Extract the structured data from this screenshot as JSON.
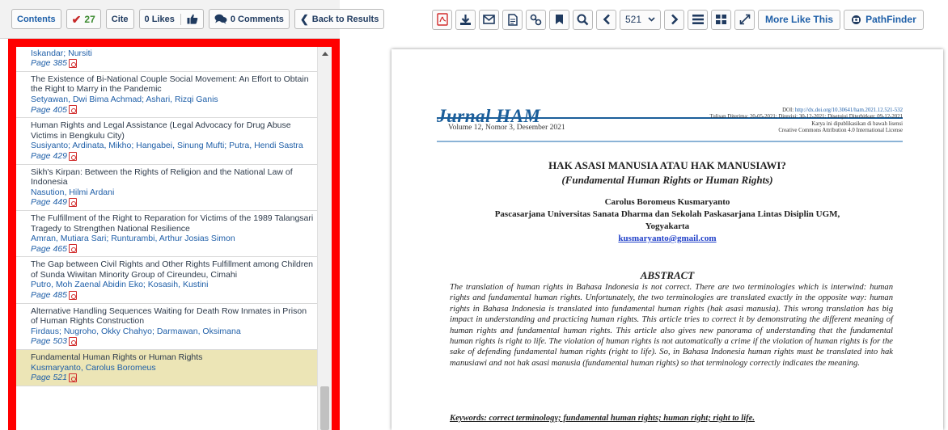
{
  "left_toolbar": {
    "contents": "Contents",
    "check_count": "27",
    "cite": "Cite",
    "likes": "0 Likes",
    "comments": "0 Comments",
    "back": "Back to Results"
  },
  "list": {
    "entries": [
      {
        "title": "",
        "authors": "Iskandar; Nursiti",
        "page": "Page 385",
        "partial": true
      },
      {
        "title": "The Existence of Bi-National Couple Social Movement: An Effort to Obtain the Right to Marry in the Pandemic",
        "authors": "Setyawan, Dwi Bima Achmad; Ashari, Rizqi Ganis",
        "page": "Page 405"
      },
      {
        "title": "Human Rights and Legal Assistance (Legal Advocacy for Drug Abuse Victims in Bengkulu City)",
        "authors": "Susiyanto; Ardinata, Mikho; Hangabei, Sinung Mufti; Putra, Hendi Sastra",
        "page": "Page 429"
      },
      {
        "title": "Sikh's Kirpan: Between the Rights of Religion and the National Law of Indonesia",
        "authors": "Nasution, Hilmi Ardani",
        "page": "Page 449"
      },
      {
        "title": "The Fulfillment of the Right to Reparation for Victims of the 1989 Talangsari Tragedy to Strengthen National Resilience",
        "authors": "Amran, Mutiara Sari; Runturambi, Arthur Josias Simon",
        "page": "Page 465"
      },
      {
        "title": "The Gap between Civil Rights and Other Rights Fulfillment among Children of Sunda Wiwitan Minority Group of Cireundeu, Cimahi",
        "authors": "Putro, Moh Zaenal Abidin Eko; Kosasih, Kustini",
        "page": "Page 485"
      },
      {
        "title": "Alternative Handling Sequences Waiting for Death Row Inmates in Prison of Human Rights Construction",
        "authors": "Firdaus; Nugroho, Okky Chahyo; Darmawan, Oksimana",
        "page": "Page 503"
      },
      {
        "title": "Fundamental Human Rights or Human Rights",
        "authors": "Kusmaryanto, Carolus Boromeus",
        "page": "Page 521",
        "active": true
      }
    ]
  },
  "right_toolbar": {
    "page_number": "521",
    "more_like_this": "More Like This",
    "pathfinder": "PathFinder"
  },
  "document": {
    "journal_name": "Jurnal HAM",
    "volume": "Volume 12, Nomor 3, Desember 2021",
    "doi_label": "DOI:",
    "doi_url": "http://dx.doi.org/10.30641/ham.2021.12.521-532",
    "dates": "Tulisan Diterima: 20-05-2021; Direvisi: 30-12-2021; Disetujui Diterbitkan: 09-12-2021",
    "license1": "Karya ini dipublikasikan di bawah lisensi",
    "license2": "Creative Commons Attribution 4.0 International License",
    "title": "HAK ASASI MANUSIA ATAU HAK MANUSIAWI?",
    "subtitle": "(Fundamental Human Rights or Human Rights)",
    "author": "Carolus Boromeus Kusmaryanto",
    "affiliation1": "Pascasarjana Universitas Sanata Dharma dan Sekolah Paskasarjana Lintas Disiplin UGM,",
    "affiliation2": "Yogyakarta",
    "email": "kusmaryanto@gmail.com",
    "abstract_heading": "ABSTRACT",
    "abstract": "The translation of human rights in Bahasa Indonesia is not correct. There are two terminologies which is interwind: human rights and fundamental human rights. Unfortunately, the two terminologies are translated exactly in the opposite way: human rights in Bahasa Indonesia is translated into fundamental human rights (hak asasi manusia). This wrong translation has big impact in understanding and practicing human rights. This article tries to correct it by demonstrating the different meaning of human rights and fundamental human rights. This article also gives new panorama of understanding that the fundamental human rights is right to life. The violation of human rights is not automatically a crime if the violation of human rights is for the sake of defending fundamental human rights (right to life). So, in Bahasa Indonesia human rights must be translated into hak manusiawi and not hak asasi manusia (fundamental human rights) so that terminology correctly indicates the meaning.",
    "keywords": "Keywords: correct terminology; fundamental human rights; human right; right to life."
  },
  "colors": {
    "highlight_border": "#ff0000",
    "active_row": "#ece5b6",
    "link_blue": "#1f5fa8",
    "journal_blue": "#1b5e9a"
  }
}
